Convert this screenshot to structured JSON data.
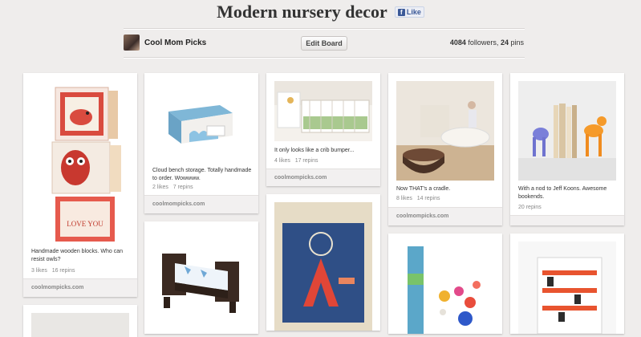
{
  "board": {
    "title": "Modern nursery decor",
    "like_label": "Like",
    "owner": "Cool Mom Picks",
    "edit_label": "Edit Board",
    "followers": "4084",
    "followers_label": "followers,",
    "pins": "24",
    "pins_label": "pins"
  },
  "pins": [
    {
      "desc": "Handmade wooden blocks. Who can resist owls?",
      "likes": "3 likes",
      "repins": "16 repins",
      "source": "coolmompicks.com",
      "image_label": "LOVE YOU"
    },
    {
      "desc": "Cloud bench storage. Totally handmade to order. Wowwww.",
      "likes": "2 likes",
      "repins": "7 repins",
      "source": "coolmompicks.com"
    },
    {
      "desc": "It only looks like a crib bumper...",
      "likes": "4 likes",
      "repins": "17 repins",
      "source": "coolmompicks.com"
    },
    {
      "desc": "Now THAT's a cradle.",
      "likes": "8 likes",
      "repins": "14 repins",
      "source": "coolmompicks.com"
    },
    {
      "desc": "With a nod to Jeff Koons. Awesome bookends.",
      "likes": "",
      "repins": "20 repins",
      "source": ""
    }
  ],
  "colors": {
    "background": "#efedec",
    "card": "#ffffff",
    "source_bar": "#f2f0f0",
    "facebook_blue": "#3b5998"
  },
  "icons": [
    "facebook-icon",
    "avatar"
  ]
}
